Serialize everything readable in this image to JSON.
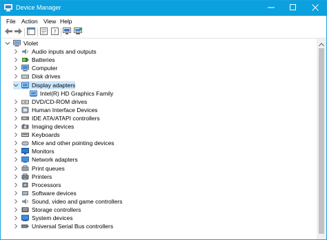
{
  "window": {
    "title": "Device Manager",
    "accent_color": "#0aa1de",
    "controls": [
      "minimize-icon",
      "maximize-icon",
      "close-icon"
    ]
  },
  "menu": [
    "File",
    "Action",
    "View",
    "Help"
  ],
  "toolbar": [
    "back-arrow-icon",
    "forward-arrow-icon",
    "properties-icon",
    "help-icon",
    "update-driver-icon",
    "scan-hardware-icon"
  ],
  "tree": {
    "root": "Violet",
    "categories": [
      {
        "label": "Audio inputs and outputs",
        "icon": "speaker-icon",
        "expanded": false
      },
      {
        "label": "Batteries",
        "icon": "battery-icon",
        "expanded": false
      },
      {
        "label": "Computer",
        "icon": "computer-icon",
        "expanded": false
      },
      {
        "label": "Disk drives",
        "icon": "disk-drive-icon",
        "expanded": false
      },
      {
        "label": "Display adapters",
        "icon": "display-adapter-icon",
        "expanded": true,
        "selected": true,
        "children": [
          "Intel(R) HD Graphics Family"
        ]
      },
      {
        "label": "DVD/CD-ROM drives",
        "icon": "dvd-drive-icon",
        "expanded": false
      },
      {
        "label": "Human Interface Devices",
        "icon": "hid-icon",
        "expanded": false
      },
      {
        "label": "IDE ATA/ATAPI controllers",
        "icon": "ide-controller-icon",
        "expanded": false
      },
      {
        "label": "Imaging devices",
        "icon": "camera-icon",
        "expanded": false
      },
      {
        "label": "Keyboards",
        "icon": "keyboard-icon",
        "expanded": false
      },
      {
        "label": "Mice and other pointing devices",
        "icon": "mouse-icon",
        "expanded": false
      },
      {
        "label": "Monitors",
        "icon": "monitor-icon",
        "expanded": false
      },
      {
        "label": "Network adapters",
        "icon": "network-adapter-icon",
        "expanded": false
      },
      {
        "label": "Print queues",
        "icon": "print-queue-icon",
        "expanded": false
      },
      {
        "label": "Printers",
        "icon": "printer-icon",
        "expanded": false
      },
      {
        "label": "Processors",
        "icon": "processor-icon",
        "expanded": false
      },
      {
        "label": "Software devices",
        "icon": "software-device-icon",
        "expanded": false
      },
      {
        "label": "Sound, video and game controllers",
        "icon": "sound-icon",
        "expanded": false
      },
      {
        "label": "Storage controllers",
        "icon": "storage-controller-icon",
        "expanded": false
      },
      {
        "label": "System devices",
        "icon": "system-device-icon",
        "expanded": false
      },
      {
        "label": "Universal Serial Bus controllers",
        "icon": "usb-icon",
        "expanded": false
      }
    ]
  }
}
